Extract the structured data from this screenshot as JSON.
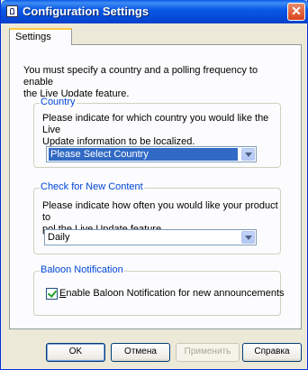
{
  "window": {
    "title": "Configuration Settings",
    "close_glyph": "✕",
    "icon": "lock-icon"
  },
  "tabs": [
    {
      "label": "Settings"
    }
  ],
  "intro": {
    "line1": "You must specify a country and a polling frequency to enable",
    "line2": "the Live Update feature."
  },
  "country": {
    "legend": "Country",
    "line1": "Please indicate for which country you would like the Live",
    "line2": "Update information to be localized.",
    "selected": "Please Select Country"
  },
  "content": {
    "legend": "Check for New Content",
    "line1": "Please indicate how often you would like your product to",
    "line2": "pol the Live Update feature.",
    "selected": "Daily"
  },
  "notification": {
    "legend": "Baloon Notification",
    "checkbox_label_prefix": "E",
    "checkbox_label_rest": "nable Baloon Notification for new announcements",
    "checked": true
  },
  "buttons": {
    "ok": "OK",
    "cancel": "Отмена",
    "apply": "Применить",
    "help": "Справка"
  },
  "colors": {
    "titlebar": "#0a5ae8",
    "legend": "#0046d5",
    "selection": "#316ac5",
    "dialog_bg": "#ece9d8"
  }
}
